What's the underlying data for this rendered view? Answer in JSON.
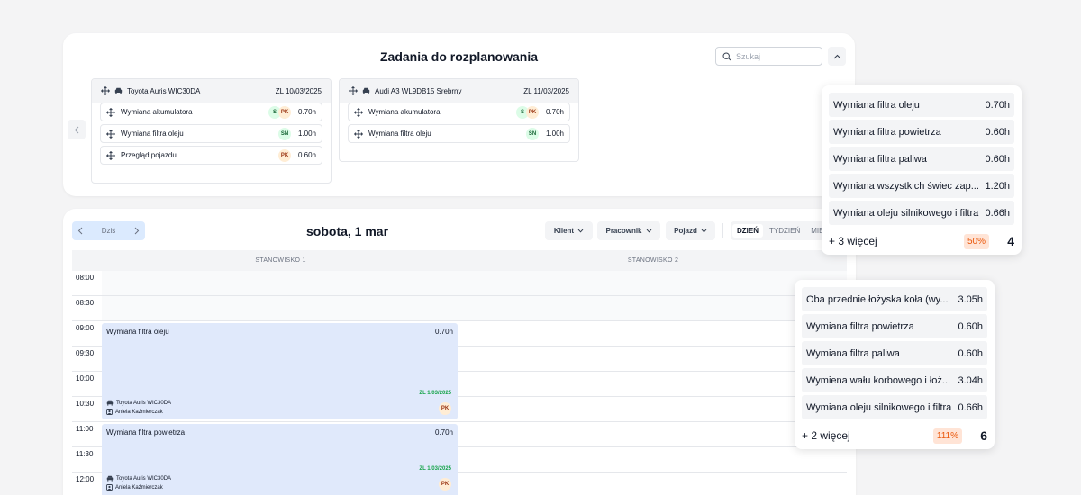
{
  "unscheduled": {
    "title": "Zadania do rozplanowania",
    "search_placeholder": "Szukaj",
    "cars": [
      {
        "name": "Toyota Auris WIC30DA",
        "date": "ZL 10/03/2025",
        "tasks": [
          {
            "name": "Wymiana akumulatora",
            "badges": [
              "S",
              "PK"
            ],
            "hours": "0.70h"
          },
          {
            "name": "Wymiana filtra oleju",
            "badges": [
              "SN"
            ],
            "hours": "1.00h"
          },
          {
            "name": "Przegląd pojazdu",
            "badges": [
              "PK"
            ],
            "hours": "0.60h"
          }
        ]
      },
      {
        "name": "Audi A3 WL9DB15 Srebrny",
        "date": "ZL 11/03/2025",
        "tasks": [
          {
            "name": "Wymiana akumulatora",
            "badges": [
              "S",
              "PK"
            ],
            "hours": "0.70h"
          },
          {
            "name": "Wymiana filtra oleju",
            "badges": [
              "SN"
            ],
            "hours": "1.00h"
          }
        ]
      }
    ]
  },
  "calendar": {
    "today_label": "Dziś",
    "date_title": "sobota, 1 mar",
    "filters": [
      "Klient",
      "Pracownik",
      "Pojazd"
    ],
    "views": [
      "DZIEŃ",
      "TYDZIEŃ",
      "MIE"
    ],
    "stations": [
      "STANOWISKO 1",
      "STANOWISKO 2"
    ],
    "times": [
      "08:00",
      "08:30",
      "09:00",
      "09:30",
      "10:00",
      "10:30",
      "11:00",
      "11:30",
      "12:00"
    ],
    "events": [
      {
        "title": "Wymiana filtra oleju",
        "hours": "0.70h",
        "date": "ZL 1/03/2025",
        "car": "Toyota Auris WIC30DA",
        "person": "Aniela Kaźmierczak",
        "badge": "PK"
      },
      {
        "title": "Wymiana filtra powietrza",
        "hours": "0.70h",
        "date": "ZL 1/03/2025",
        "car": "Toyota Auris WIC30DA",
        "person": "Aniela Kaźmierczak",
        "badge": "PK"
      }
    ]
  },
  "popover1": {
    "items": [
      {
        "name": "Wymiana filtra oleju",
        "hours": "0.70h"
      },
      {
        "name": "Wymiana filtra powietrza",
        "hours": "0.60h"
      },
      {
        "name": "Wymiana filtra paliwa",
        "hours": "0.60h"
      },
      {
        "name": "Wymiana wszystkich świec zap...",
        "hours": "1.20h"
      },
      {
        "name": "Wymiana oleju silnikowego i filtra",
        "hours": "0.66h"
      }
    ],
    "more": "+ 3 więcej",
    "percent": "50%",
    "count": "4"
  },
  "popover2": {
    "items": [
      {
        "name": "Oba przednie łożyska koła (wy...",
        "hours": "3.05h"
      },
      {
        "name": "Wymiana filtra powietrza",
        "hours": "0.60h"
      },
      {
        "name": "Wymiana filtra paliwa",
        "hours": "0.60h"
      },
      {
        "name": "Wymiena wału korbowego i łoż...",
        "hours": "3.04h"
      },
      {
        "name": "Wymiana oleju silnikowego i filtra",
        "hours": "0.66h"
      }
    ],
    "more": "+ 2 więcej",
    "percent": "111%",
    "count": "6"
  },
  "colors": {
    "accent": "#dbeafe",
    "event_bg": "#e0e9fb",
    "date_green": "#16a34a",
    "pct_bg": "#ffe4d6",
    "pct_text": "#ea580c"
  }
}
